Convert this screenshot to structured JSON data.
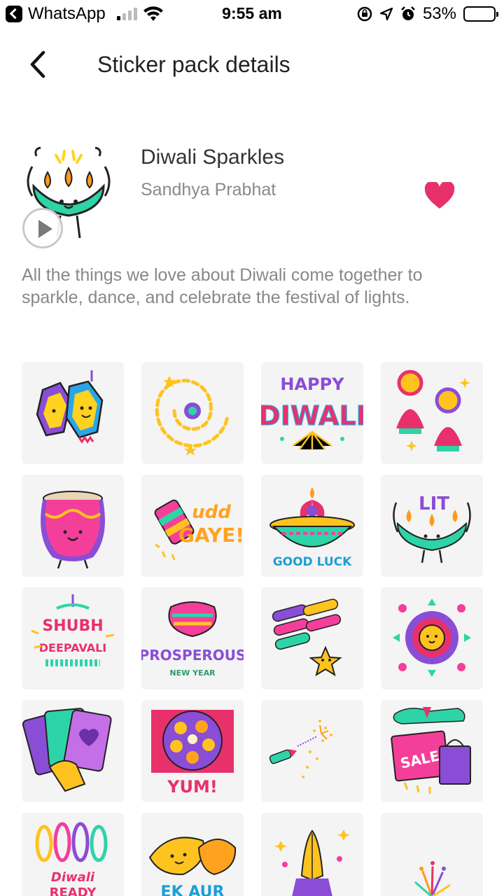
{
  "status_bar": {
    "app_back_label": "WhatsApp",
    "time": "9:55 am",
    "battery": "53%",
    "battery_level": 0.53
  },
  "nav": {
    "title": "Sticker pack details"
  },
  "pack": {
    "name": "Diwali Sparkles",
    "author": "Sandhya Prabhat",
    "description": "All the things we love about Diwali come together to sparkle, dance, and celebrate the festival of lights.",
    "favorited": true
  },
  "stickers": {
    "happy_diwali": [
      "HAPPY",
      "DIWALI"
    ],
    "udd_gaye": [
      "udd",
      "GAYE!"
    ],
    "good_luck": "GOOD LUCK",
    "lit": "LIT",
    "shubh_deepavali": [
      "SHUBH",
      "DEEPAVALI"
    ],
    "prosperous": [
      "PROSPEROUS",
      "NEW YEAR"
    ],
    "yum": "YUM!",
    "sale": "SALE",
    "diwali_ready": [
      "Diwali",
      "READY"
    ],
    "ek_aur": "EK AUR"
  },
  "colors": {
    "heart": "#e8316b",
    "cell_bg": "#f4f4f4",
    "battery_fill": "#ffcc00"
  }
}
